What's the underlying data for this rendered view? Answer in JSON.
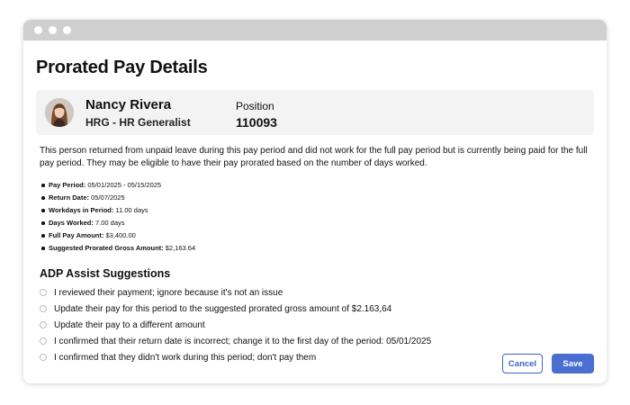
{
  "page": {
    "title": "Prorated Pay Details"
  },
  "employee": {
    "name": "Nancy Rivera",
    "role": "HRG - HR Generalist",
    "position_label": "Position",
    "position_value": "110093"
  },
  "description": "This person returned from unpaid leave during this pay period and did not work for the full pay period but is currently being paid for the full pay period. They may be eligible to have their pay prorated based on the number of days worked.",
  "details": [
    {
      "label": "Pay Period:",
      "value": "05/01/2025 - 05/15/2025"
    },
    {
      "label": "Return Date:",
      "value": "05/07/2025"
    },
    {
      "label": "Workdays in Period:",
      "value": "11.00 days"
    },
    {
      "label": "Days Worked:",
      "value": "7.00 days"
    },
    {
      "label": "Full Pay Amount:",
      "value": "$3,400.00"
    },
    {
      "label": "Suggested Prorated Gross Amount:",
      "value": "$2,163.64"
    }
  ],
  "assist": {
    "title": "ADP Assist Suggestions",
    "options": [
      "I reviewed their payment; ignore because it's not an issue",
      "Update their pay for this period to the suggested prorated gross amount of $2.163,64",
      "Update their pay to a different amount",
      "I confirmed that their return date is incorrect; change it to the first day of the period: 05/01/2025",
      "I confirmed that they didn't work during this period; don't pay them"
    ]
  },
  "buttons": {
    "cancel": "Cancel",
    "save": "Save"
  },
  "colors": {
    "accent": "#4a6fd1",
    "titlebar": "#cfcfcf",
    "card_bg": "#f3f3f3"
  }
}
